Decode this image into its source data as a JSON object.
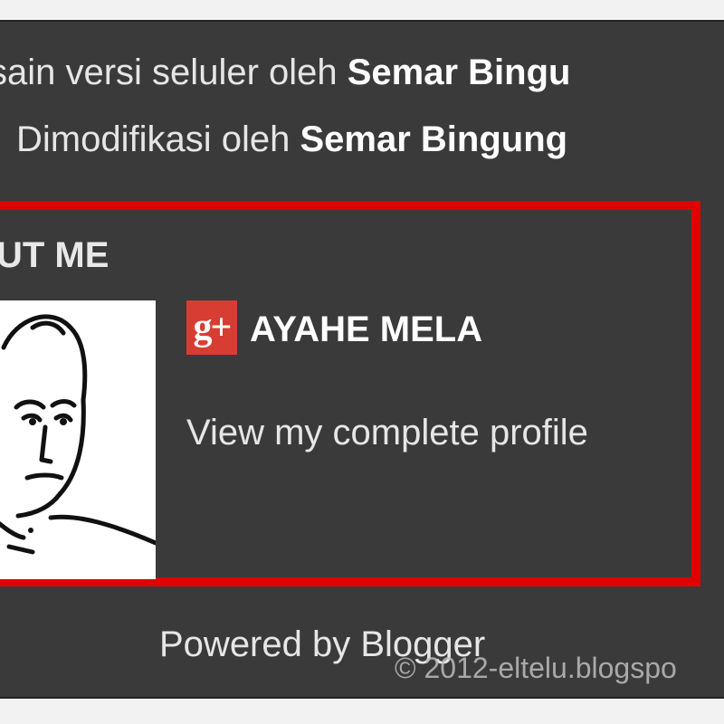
{
  "credits": {
    "line1_prefix": "sain versi seluler oleh ",
    "line1_author": "Semar Bingu",
    "line2_prefix": "Dimodifikasi oleh ",
    "line2_author": "Semar Bingung"
  },
  "about": {
    "title_visible": "UT ME",
    "avatar_alt": "profile photo",
    "gplus_icon": "google-plus-icon",
    "gplus_glyph": "g+",
    "profile_name": "AYAHE MELA",
    "profile_link": "View my complete profile"
  },
  "footer": {
    "powered_by": "Powered by Blogger",
    "watermark": "© 2012-eltelu.blogspo"
  },
  "colors": {
    "background": "#3a3a3a",
    "highlight_border": "#e00000",
    "gplus_red": "#d73d32",
    "text": "#e6e6e6"
  }
}
